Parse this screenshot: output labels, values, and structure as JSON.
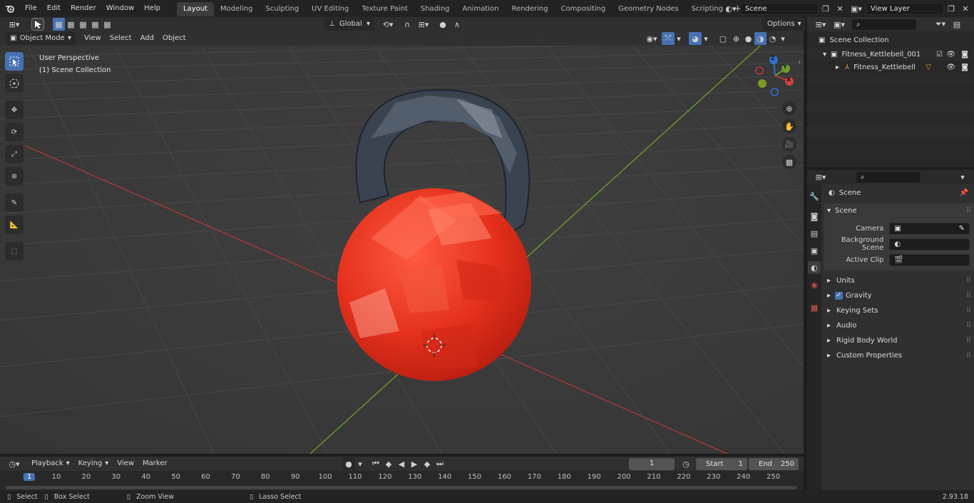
{
  "menu": {
    "file": "File",
    "edit": "Edit",
    "render": "Render",
    "window": "Window",
    "help": "Help"
  },
  "workspaces": [
    {
      "label": "Layout",
      "active": true
    },
    {
      "label": "Modeling"
    },
    {
      "label": "Sculpting"
    },
    {
      "label": "UV Editing"
    },
    {
      "label": "Texture Paint"
    },
    {
      "label": "Shading"
    },
    {
      "label": "Animation"
    },
    {
      "label": "Rendering"
    },
    {
      "label": "Compositing"
    },
    {
      "label": "Geometry Nodes"
    },
    {
      "label": "Scripting"
    }
  ],
  "scene_field": "Scene",
  "view_layer_field": "View Layer",
  "viewport_header": {
    "mode": "Object Mode",
    "view": "View",
    "select": "Select",
    "add": "Add",
    "object": "Object",
    "transform": "Global",
    "options": "Options"
  },
  "viewport": {
    "perspective": "User Perspective",
    "collection": "(1) Scene Collection"
  },
  "gizmo": {
    "z": "Z",
    "y": "Y",
    "x": "X"
  },
  "outliner": {
    "root": "Scene Collection",
    "items": [
      {
        "label": "Fitness_Kettlebell_001"
      },
      {
        "label": "Fitness_Kettlebell"
      }
    ]
  },
  "properties": {
    "context": "Scene",
    "section": "Scene",
    "camera_label": "Camera",
    "bg_scene_label": "Background Scene",
    "active_clip_label": "Active Clip",
    "panels": [
      {
        "label": "Units"
      },
      {
        "label": "Gravity"
      },
      {
        "label": "Keying Sets"
      },
      {
        "label": "Audio"
      },
      {
        "label": "Rigid Body World"
      },
      {
        "label": "Custom Properties"
      }
    ]
  },
  "timeline": {
    "playback": "Playback",
    "keying": "Keying",
    "view": "View",
    "marker": "Marker",
    "current_frame": "1",
    "start_label": "Start",
    "start": "1",
    "end_label": "End",
    "end": "250",
    "ticks": [
      "1",
      "10",
      "20",
      "30",
      "40",
      "50",
      "60",
      "70",
      "80",
      "90",
      "100",
      "110",
      "120",
      "130",
      "140",
      "150",
      "160",
      "170",
      "180",
      "190",
      "200",
      "210",
      "220",
      "230",
      "240",
      "250"
    ]
  },
  "status": {
    "select": "Select",
    "box_select": "Box Select",
    "zoom_view": "Zoom View",
    "lasso_select": "Lasso Select",
    "version": "2.93.18"
  },
  "colors": {
    "accent": "#4772b3",
    "kettlebell": "#e8321e",
    "grid_x": "#b03c3c",
    "grid_y": "#6f9a2f"
  }
}
